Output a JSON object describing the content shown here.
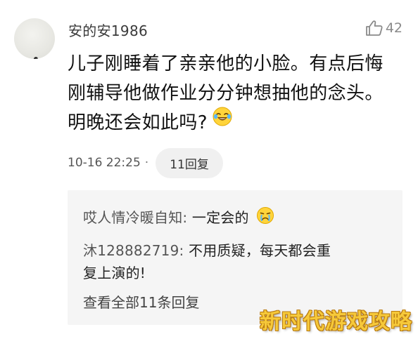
{
  "comment": {
    "username": "安的安1986",
    "like_count": "42",
    "text_lines": [
      "儿子刚睡着了亲亲他的小脸。有点后悔",
      "刚辅导他做作业分分钟想抽他的念头。",
      "明晚还会如此吗?"
    ],
    "timestamp": "10-16 22:25",
    "separator": "·",
    "reply_count_label": "11回复"
  },
  "replies": [
    {
      "name": "哎人情冷暖自知:",
      "text": " 一定会的"
    },
    {
      "name": "沐128882719:",
      "text": " 不用质疑，每天都会重",
      "continuation": "复上演的!"
    }
  ],
  "view_all_label": "查看全部11条回复",
  "watermark": "新时代游戏攻略",
  "icons": {
    "like": "thumbs-up-icon",
    "emoji_laugh": "laughing-crying-emoji",
    "emoji_cry": "crying-emoji"
  },
  "colors": {
    "watermark": "#f6c93a",
    "reply_bg": "#f5f5f5"
  }
}
